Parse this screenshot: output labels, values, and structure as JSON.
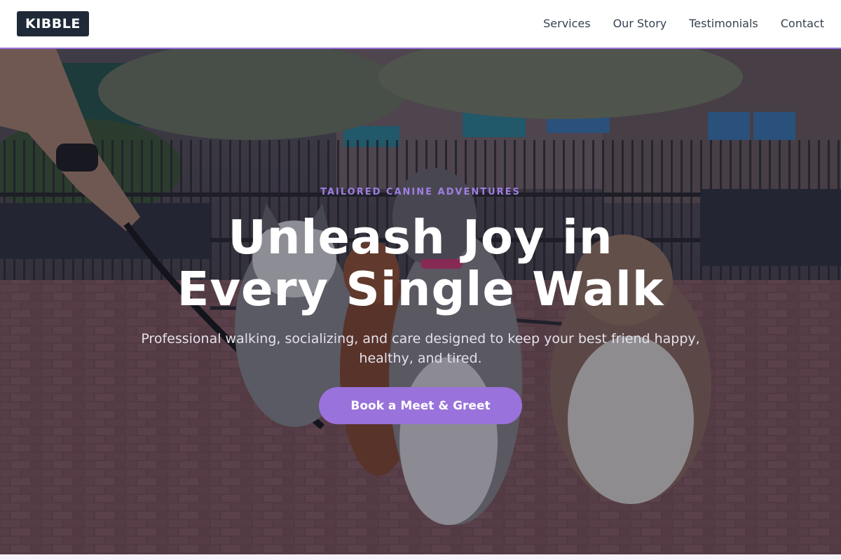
{
  "brand": {
    "logo_text": "KIBBLE"
  },
  "nav": {
    "items": [
      {
        "label": "Services"
      },
      {
        "label": "Our Story"
      },
      {
        "label": "Testimonials"
      },
      {
        "label": "Contact"
      }
    ]
  },
  "hero": {
    "eyebrow": "TAILORED CANINE ADVENTURES",
    "headline_line1": "Unleash Joy in",
    "headline_line2": "Every Single Walk",
    "subtext": "Professional walking, socializing, and care designed to keep your best friend happy, healthy, and tired.",
    "cta_label": "Book a Meet & Greet",
    "background_image": "dogs-on-leash-in-park-photo"
  },
  "colors": {
    "accent": "#9a72db",
    "logo_bg": "#1f2937",
    "nav_text": "#374151",
    "eyebrow": "#a07ee3"
  }
}
